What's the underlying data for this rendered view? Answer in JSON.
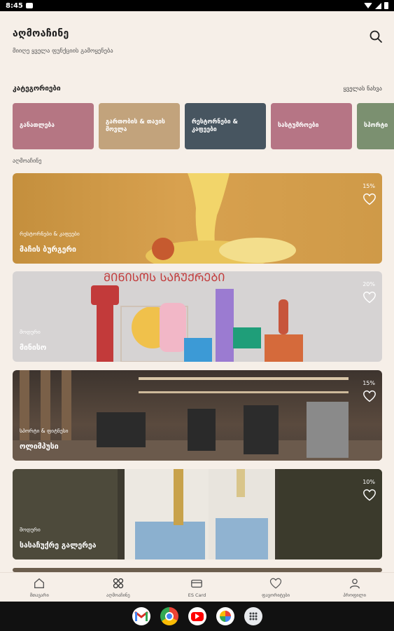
{
  "status": {
    "time": "8:45"
  },
  "header": {
    "title": "აღმოაჩინე",
    "subtitle": "მიიღე ყველა ფუნქციის გამოყენება"
  },
  "categories": {
    "title": "კატეგორიები",
    "see_all": "ყველას ნახვა",
    "items": [
      {
        "label": "განათლება",
        "color": "#b57683"
      },
      {
        "label": "გართობის & თავის მოვლა",
        "color": "#c2a37c"
      },
      {
        "label": "რესტორნები & კაფეები",
        "color": "#475560"
      },
      {
        "label": "სასტუმროები",
        "color": "#b67585"
      },
      {
        "label": "სპორტი",
        "color": "#7b9070"
      }
    ]
  },
  "offers": {
    "label": "აღმოაჩინე",
    "items": [
      {
        "category": "რესტორნები & კაფეები",
        "name": "მაჩის ბურგერი",
        "discount": "15%"
      },
      {
        "category": "მოდური",
        "name": "მინისო",
        "discount": "20%"
      },
      {
        "category": "სპორტი & ფიტნესი",
        "name": "ოლიმპუსი",
        "discount": "15%"
      },
      {
        "category": "მოდური",
        "name": "სასაჩუქრე გალერეა",
        "discount": "10%"
      }
    ]
  },
  "nav": {
    "items": [
      {
        "label": "მთავარი",
        "icon": "home-icon"
      },
      {
        "label": "აღმოაჩინე",
        "icon": "grid-icon"
      },
      {
        "label": "ES Card",
        "icon": "card-icon"
      },
      {
        "label": "ფავორიტები",
        "icon": "heart-icon"
      },
      {
        "label": "პროფილი",
        "icon": "user-icon"
      }
    ]
  },
  "dock": {
    "apps": [
      "gmail-icon",
      "chrome-icon",
      "youtube-icon",
      "photos-icon",
      "app-drawer-icon"
    ]
  }
}
